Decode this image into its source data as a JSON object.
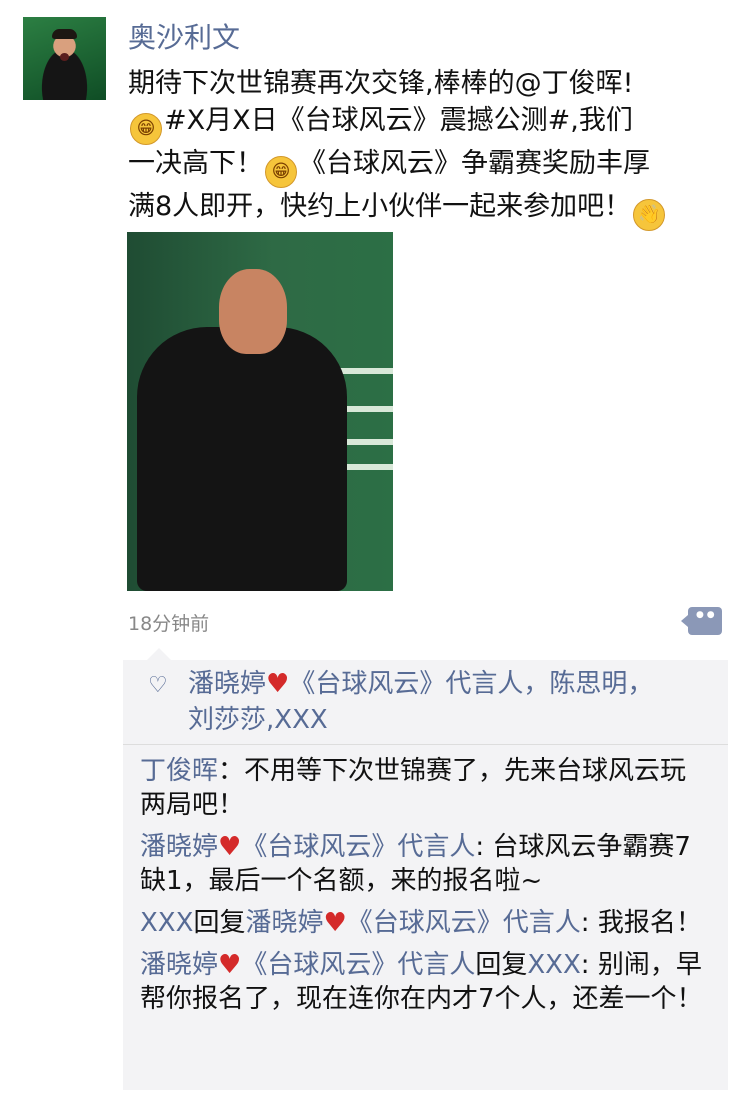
{
  "post": {
    "author": "奥沙利文",
    "text_line1": "期待下次世锦赛再次交锋,棒棒的@丁俊晖!",
    "text_line2_a": "#X月X日《台球风云》震撼公测#,我们",
    "text_line3_a": "一决高下！",
    "text_line3_b": "《台球风云》争霸赛奖励丰厚",
    "text_line4": "满8人即开，快约上小伙伴一起来参加吧！",
    "time": "18分钟前",
    "icons": {
      "emoji_grin": "grinning-face-icon",
      "emoji_hand": "hand-icon"
    }
  },
  "likes": {
    "heart_icon": "heart-outline-icon",
    "names": [
      "潘晓婷",
      "《台球风云》代言人",
      "陈思明",
      "刘莎莎",
      "XXX"
    ],
    "separator": "，",
    "separator_2": ","
  },
  "comments": [
    {
      "author": "丁俊晖",
      "text": "：不用等下次世锦赛了，先来台球风云玩两局吧！"
    },
    {
      "author": "潘晓婷",
      "author_suffix": "《台球风云》代言人",
      "text": ": 台球风云争霸赛7缺1，最后一个名额，来的报名啦~"
    },
    {
      "author": "XXX",
      "reply_word": "回复",
      "reply_to": "潘晓婷",
      "reply_to_suffix": "《台球风云》代言人",
      "text": ": 我报名！"
    },
    {
      "author": "潘晓婷",
      "author_suffix": "《台球风云》代言人",
      "reply_word": "回复",
      "reply_to": "XXX",
      "text": ": 别闹，早帮你报名了，现在连你在内才7个人，还差一个！"
    }
  ],
  "colors": {
    "link_blue": "#576b95",
    "heart_red": "#d42a2a",
    "time_grey": "#888888",
    "comment_bg": "#f3f3f5"
  }
}
